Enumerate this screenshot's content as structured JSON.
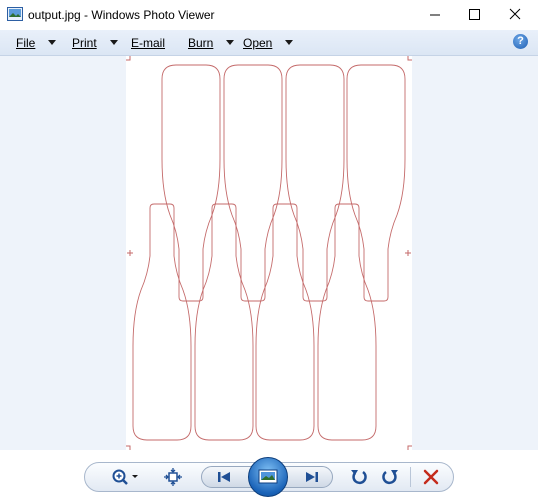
{
  "window": {
    "title": "output.jpg - Windows Photo Viewer",
    "controls": [
      "minimize-icon",
      "maximize-icon",
      "close-icon"
    ]
  },
  "menu": {
    "items": [
      {
        "label": "File"
      },
      {
        "label": "Print"
      },
      {
        "label": "E-mail"
      },
      {
        "label": "Burn"
      },
      {
        "label": "Open"
      }
    ],
    "help_label": "?"
  },
  "photo": {
    "content": "bottle-outlines",
    "bottle_count": 8,
    "outline_color": "#c46a6a"
  },
  "toolbar": {
    "buttons": [
      "zoom-icon",
      "actual-size-icon",
      "previous-icon",
      "slideshow-icon",
      "next-icon",
      "rotate-counterclockwise-icon",
      "rotate-clockwise-icon",
      "delete-icon"
    ],
    "accent_color": "#1a63b8",
    "delete_color": "#c42b1c"
  }
}
